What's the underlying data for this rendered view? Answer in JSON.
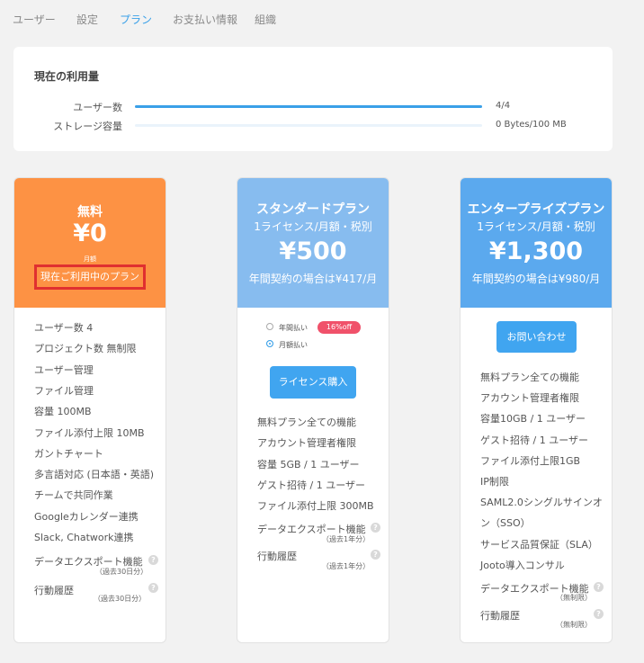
{
  "nav": {
    "tabs": [
      {
        "label": "ユーザー"
      },
      {
        "label": "設定"
      },
      {
        "label": "プラン"
      },
      {
        "label": "お支払い情報"
      },
      {
        "label": "組織"
      }
    ],
    "active": "プラン"
  },
  "usage": {
    "title": "現在の利用量",
    "rows": [
      {
        "label": "ユーザー数",
        "value": "4/4",
        "fill_fraction": 1.0
      },
      {
        "label": "ストレージ容量",
        "value": "0 Bytes/100 MB",
        "fill_fraction": 0.0
      }
    ]
  },
  "plans": {
    "free": {
      "name": "無料",
      "price": "¥0",
      "period": "月額",
      "current_label": "現在ご利用中のプラン",
      "features": [
        "ユーザー数 4",
        "プロジェクト数 無制限",
        "ユーザー管理",
        "ファイル管理",
        "容量 100MB",
        "ファイル添付上限 10MB",
        "ガントチャート",
        "多言語対応 (日本語・英語)",
        "チームで共同作業",
        "Googleカレンダー連携",
        "Slack, Chatwork連携"
      ],
      "export_label": "データエクスポート機能",
      "export_note": "（過去30日分）",
      "history_label": "行動履歴",
      "history_note": "（過去30日分）"
    },
    "standard": {
      "name": "スタンダードプラン",
      "subtitle": "1ライセンス/月額・税別",
      "price": "¥500",
      "annual": "年間契約の場合は¥417/月",
      "radio_annual": "年間払い",
      "discount": "16%off",
      "radio_monthly": "月額払い",
      "buy_button": "ライセンス購入",
      "features": [
        "無料プラン全ての機能",
        "アカウント管理者権限",
        "容量 5GB / 1 ユーザー",
        "ゲスト招待 / 1 ユーザー",
        "ファイル添付上限 300MB"
      ],
      "export_label": "データエクスポート機能",
      "export_note": "（過去1年分）",
      "history_label": "行動履歴",
      "history_note": "（過去1年分）"
    },
    "enterprise": {
      "name": "エンタープライズプラン",
      "subtitle": "1ライセンス/月額・税別",
      "price": "¥1,300",
      "annual": "年間契約の場合は¥980/月",
      "contact_button": "お問い合わせ",
      "features": [
        "無料プラン全ての機能",
        "アカウント管理者権限",
        "容量10GB / 1 ユーザー",
        "ゲスト招待 / 1 ユーザー",
        "ファイル添付上限1GB",
        "IP制限",
        "SAML2.0シングルサインオ",
        "ン（SSO）",
        "サービス品質保証（SLA）",
        "Jooto導入コンサル"
      ],
      "export_label": "データエクスポート機能",
      "export_note": "（無制限）",
      "history_label": "行動履歴",
      "history_note": "（無制限）"
    }
  },
  "help_glyph": "?"
}
